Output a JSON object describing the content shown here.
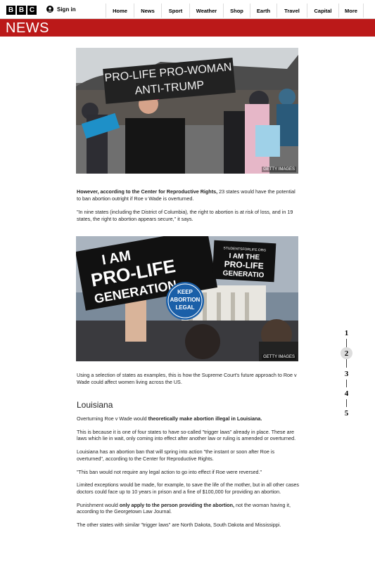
{
  "header": {
    "logo_letters": [
      "B",
      "B",
      "C"
    ],
    "signin_label": "Sign in",
    "nav": [
      "Home",
      "News",
      "Sport",
      "Weather",
      "Shop",
      "Earth",
      "Travel",
      "Capital",
      "More"
    ]
  },
  "news_bar": {
    "label": "NEWS",
    "color": "#bb1919"
  },
  "photo1": {
    "sign_text_line1": "PRO-LIFE PRO-WOMAN",
    "sign_text_line2": "ANTI-TRUMP",
    "credit": "GETTY IMAGES"
  },
  "para1": {
    "bold": "However, according to the Center for Reproductive Rights,",
    "rest": " 23 states would have the potential to ban abortion outright if Roe v Wade is overturned."
  },
  "para2": "\"In nine states (including the District of Columbia), the right to abortion is at risk of loss, and in 19 states, the right to abortion appears secure,\" it says.",
  "photo2": {
    "sign1_line1": "I AM",
    "sign1_line2": "PRO-LIFE",
    "sign1_line3": "GENERATION",
    "sign2_line1": "I AM THE",
    "sign2_line2": "PRO-LIFE",
    "sign2_line3": "GENERATIO",
    "sign2_small": "STUDENTSFORLIFE.ORG",
    "sign3_line1": "KEEP",
    "sign3_line2": "ABORTION",
    "sign3_line3": "LEGAL",
    "credit": "GETTY IMAGES"
  },
  "para3": "Using a selection of states as examples, this is how the Supreme Court's future approach to Roe v Wade could affect women living across the US.",
  "section_heading": "Louisiana",
  "para4": {
    "pre": "Overturning Roe v Wade would ",
    "bold": "theoretically make abortion illegal in Louisiana."
  },
  "para5": "This is because it is one of four states to have so-called \"trigger laws\" already in place. These are laws which lie in wait, only coming into effect after another law or ruling is amended or overturned.",
  "para6": "Louisiana has an abortion ban that will spring into action \"the instant or soon after Roe is overturned\", according to the Center for Reproductive Rights.",
  "para7": "\"This ban would not require any legal action to go into effect if Roe were reversed.\"",
  "para8": "Limited exceptions would be made, for example, to save the life of the mother, but in all other cases doctors could face up to 10 years in prison and a fine of $100,000 for providing an abortion.",
  "para9": {
    "pre": "Punishment would ",
    "bold": "only apply to the person providing the abortion,",
    "rest": " not the woman having it, according to the Georgetown Law Journal."
  },
  "para10": "The other states with similar \"trigger laws\" are North Dakota, South Dakota and Mississippi.",
  "steps": {
    "items": [
      "1",
      "2",
      "3",
      "4",
      "5"
    ],
    "active_index": 1
  }
}
